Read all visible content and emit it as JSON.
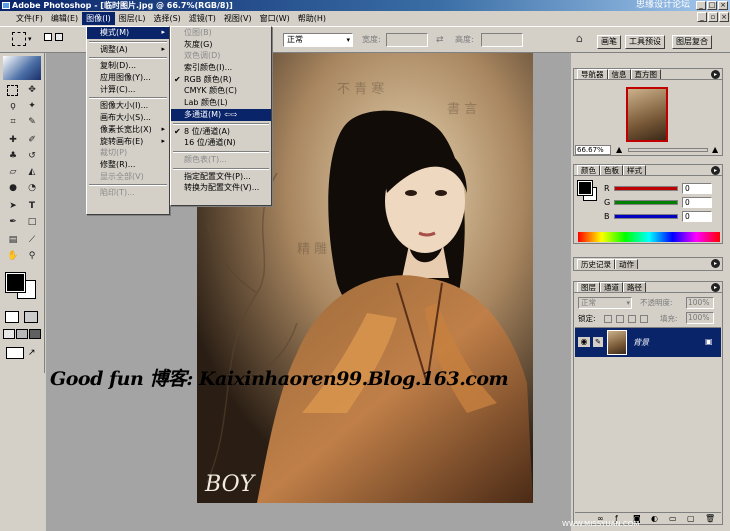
{
  "titlebar": {
    "title": "Adobe Photoshop - [临时图片.jpg @ 66.7%(RGB/8)]",
    "watermark": "思缘设计论坛",
    "win_min": "_",
    "win_max": "□",
    "win_close": "×"
  },
  "menubar": {
    "items": [
      "文件(F)",
      "编辑(E)",
      "图像(I)",
      "图层(L)",
      "选择(S)",
      "滤镜(T)",
      "视图(V)",
      "窗口(W)",
      "帮助(H)"
    ]
  },
  "optionsbar": {
    "style_value": "正常",
    "width_label": "宽度:",
    "height_label": "高度:",
    "swap_glyph": "⇄",
    "tabs": [
      "画笔",
      "工具预设",
      "图层复合"
    ]
  },
  "image_menu": {
    "items": [
      {
        "label": "模式(M)",
        "arrow": "▸",
        "state": "selected"
      },
      {
        "sep": true
      },
      {
        "label": "调整(A)",
        "arrow": "▸"
      },
      {
        "sep": true
      },
      {
        "label": "复制(D)..."
      },
      {
        "label": "应用图像(Y)..."
      },
      {
        "label": "计算(C)..."
      },
      {
        "sep": true
      },
      {
        "label": "图像大小(I)..."
      },
      {
        "label": "画布大小(S)..."
      },
      {
        "label": "像素长宽比(X)",
        "arrow": "▸"
      },
      {
        "label": "旋转画布(E)",
        "arrow": "▸"
      },
      {
        "label": "裁切(P)",
        "state": "disabled"
      },
      {
        "label": "修整(R)..."
      },
      {
        "label": "显示全部(V)",
        "state": "disabled"
      },
      {
        "sep": true
      },
      {
        "label": "陷印(T)...",
        "state": "disabled"
      }
    ]
  },
  "mode_menu": {
    "items": [
      {
        "label": "位图(B)",
        "state": "disabled"
      },
      {
        "label": "灰度(G)"
      },
      {
        "label": "双色调(D)",
        "state": "disabled"
      },
      {
        "label": "索引颜色(I)..."
      },
      {
        "label": "RGB 颜色(R)",
        "check": "✔"
      },
      {
        "label": "CMYK 颜色(C)"
      },
      {
        "label": "Lab 颜色(L)"
      },
      {
        "label": "多通道(M)",
        "state": "selected",
        "extra": "⇦⇨"
      },
      {
        "sep": true
      },
      {
        "label": "8 位/通道(A)",
        "check": "✔"
      },
      {
        "label": "16 位/通道(N)"
      },
      {
        "sep": true
      },
      {
        "label": "颜色表(T)...",
        "state": "disabled"
      },
      {
        "sep": true
      },
      {
        "label": "指定配置文件(P)..."
      },
      {
        "label": "转换为配置文件(V)..."
      }
    ]
  },
  "navigator": {
    "tabs": [
      "导航器",
      "信息",
      "直方图"
    ],
    "zoom": "66.67%"
  },
  "color_panel": {
    "tabs": [
      "颜色",
      "色板",
      "样式"
    ],
    "channels": [
      {
        "label": "R",
        "value": "0",
        "color": "#c00000"
      },
      {
        "label": "G",
        "value": "0",
        "color": "#008000"
      },
      {
        "label": "B",
        "value": "0",
        "color": "#0000c0"
      }
    ]
  },
  "history_panel": {
    "tabs": [
      "历史记录",
      "动作"
    ]
  },
  "layers_panel": {
    "tabs": [
      "图层",
      "通道",
      "路径"
    ],
    "blend": "正常",
    "opacity_label": "不透明度:",
    "opacity": "100%",
    "lock_label": "锁定:",
    "fill_label": "填充:",
    "fill": "100%",
    "layer_name": "背景"
  },
  "overlay": {
    "text": "Good fun 博客: Kaixinhaoren99.Blog.163.com",
    "logo": "BOY",
    "corner": "WWW.MISSYUAN.COM"
  },
  "colors": {
    "accent": "#0a246a",
    "bg": "#d4d0c8",
    "canvas": "#a4a4a4"
  }
}
